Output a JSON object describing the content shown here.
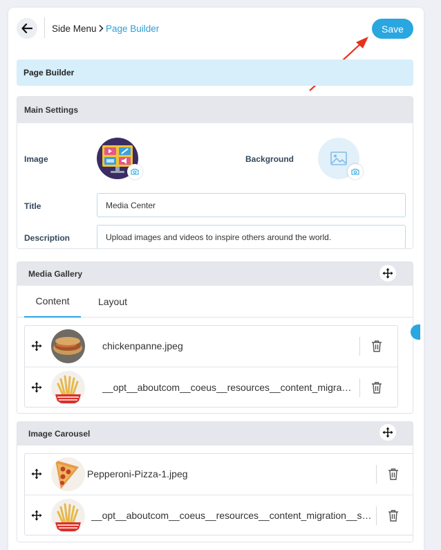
{
  "header": {
    "breadcrumb_root": "Side Menu",
    "breadcrumb_current": "Page Builder",
    "save_label": "Save"
  },
  "banner": {
    "title": "Page Builder"
  },
  "main_settings": {
    "title": "Main Settings",
    "image_label": "Image",
    "background_label": "Background",
    "title_label": "Title",
    "title_value": "Media Center",
    "description_label": "Description",
    "description_value": "Upload images and videos to inspire others around the world."
  },
  "media_gallery": {
    "title": "Media Gallery",
    "tabs": [
      {
        "label": "Content",
        "active": true
      },
      {
        "label": "Layout",
        "active": false
      }
    ],
    "items": [
      {
        "filename": "chickenpanne.jpeg",
        "thumb": "sandwich"
      },
      {
        "filename": "__opt__aboutcom__coeus__resources__content_migration__serious_eats__seriouseats.com__2018__04__20180309-french-fries-vicky-wasik-15-5a9844742c2446c7a7be9fbd41b6e27d.jpg",
        "thumb": "fries"
      }
    ]
  },
  "image_carousel": {
    "title": "Image Carousel",
    "items": [
      {
        "filename": "Pepperoni-Pizza-1.jpeg",
        "thumb": "pizza"
      },
      {
        "filename": "__opt__aboutcom__coeus__resources__content_migration__serious_eats__seriouseats.com__2018__04__20180309-french-fries-vicky-wasik-15-5a9844742c2446c7a7be9fbd41b6e27d.jpg",
        "thumb": "fries"
      }
    ]
  },
  "colors": {
    "accent": "#2aa6e0",
    "banner_bg": "#d7eefb",
    "section_header_bg": "#e5e7ec",
    "annotation_arrow": "#e8321e"
  },
  "icons": {
    "back": "arrow-left-icon",
    "breadcrumb_separator": "chevron-right-icon",
    "camera": "camera-icon",
    "placeholder": "image-placeholder-icon",
    "move": "move-arrows-icon",
    "delete": "trash-icon"
  }
}
